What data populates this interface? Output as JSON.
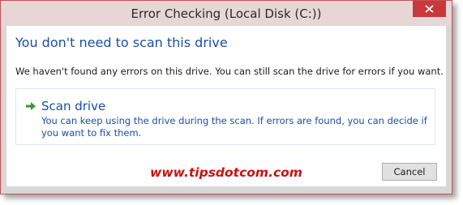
{
  "window": {
    "title": "Error Checking (Local Disk (C:))",
    "close_icon": "close-icon"
  },
  "dialog": {
    "heading": "You don't need to scan this drive",
    "message": "We haven't found any errors on this drive. You can still scan the drive for errors if you want.",
    "scan_option": {
      "icon": "green-arrow-icon",
      "title": "Scan drive",
      "description": "You can keep using the drive during the scan. If errors are found, you can decide if you want to fix them."
    },
    "watermark": "www.tipsdotcom.com",
    "cancel_label": "Cancel"
  },
  "colors": {
    "heading": "#1a4fa3",
    "close_button": "#c7393a",
    "watermark": "#cc1111",
    "arrow": "#2e9b2e"
  }
}
